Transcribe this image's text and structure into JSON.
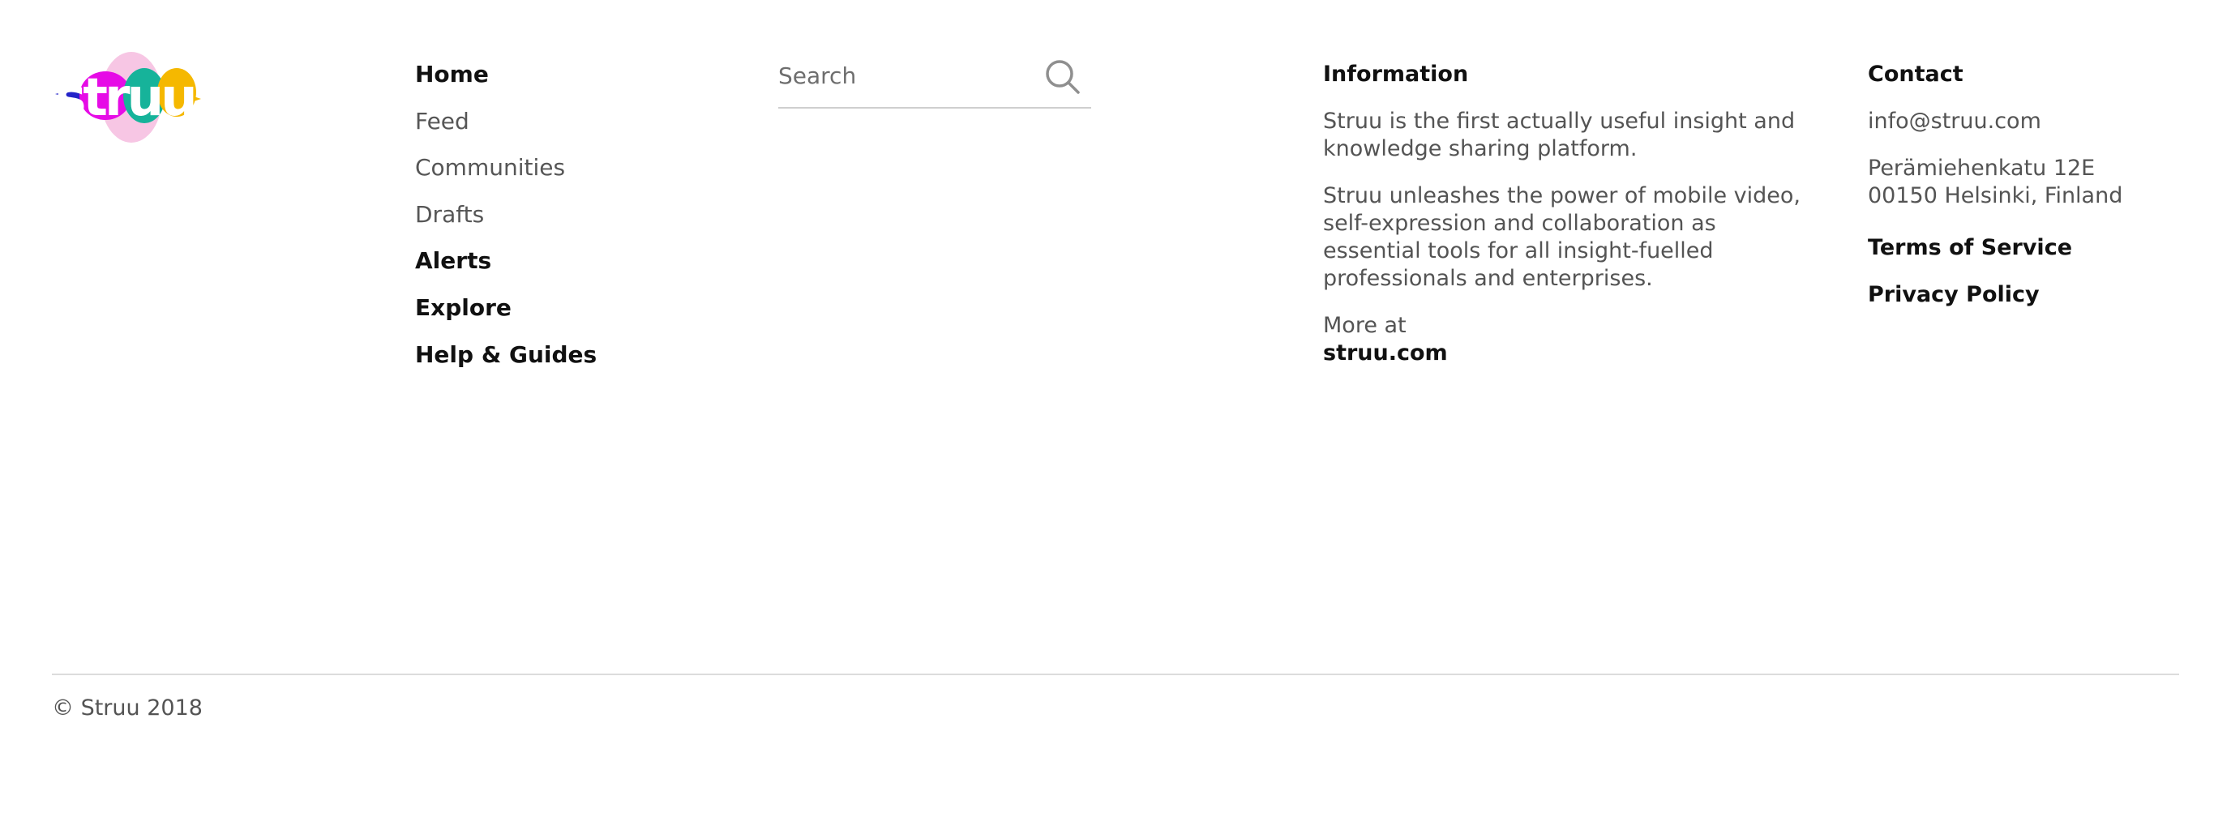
{
  "logo": {
    "alt": "struu"
  },
  "nav": {
    "items": [
      {
        "label": "Home",
        "bold": true
      },
      {
        "label": "Feed",
        "bold": false
      },
      {
        "label": "Communities",
        "bold": false
      },
      {
        "label": "Drafts",
        "bold": false
      },
      {
        "label": "Alerts",
        "bold": true
      },
      {
        "label": "Explore",
        "bold": true
      },
      {
        "label": "Help & Guides",
        "bold": true
      }
    ]
  },
  "search": {
    "placeholder": "Search",
    "value": "",
    "icon": "search-icon"
  },
  "information": {
    "heading": "Information",
    "paragraph1": "Struu is the first actually useful insight and knowledge sharing platform.",
    "paragraph2": "Struu unleashes the power of mobile video, self-expression and collaboration as essential tools for all insight-fuelled professionals and enterprises.",
    "more_at": "More at",
    "link": "struu.com"
  },
  "contact": {
    "heading": "Contact",
    "email": "info@struu.com",
    "address_line1": "Perämiehenkatu 12E",
    "address_line2": "00150 Helsinki, Finland",
    "terms": "Terms of Service",
    "privacy": "Privacy Policy"
  },
  "copyright": "© Struu 2018",
  "colors": {
    "text_dark": "#111111",
    "text_body": "#545454",
    "divider": "#dcdcdc",
    "logo_magenta": "#e60be6",
    "logo_blue": "#2323c8",
    "logo_teal": "#16b39a",
    "logo_yellow": "#f5b800",
    "logo_pink": "#f7c6e4"
  }
}
